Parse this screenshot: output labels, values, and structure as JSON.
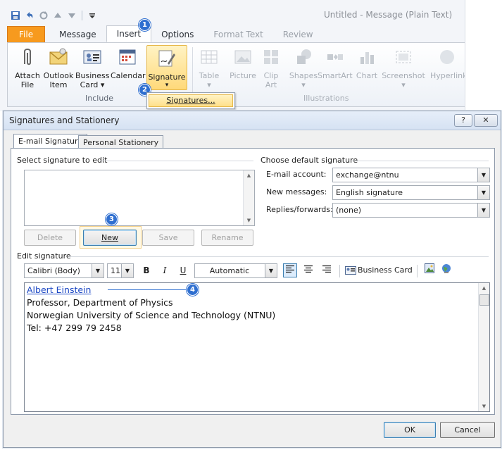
{
  "window": {
    "title": "Untitled - Message (Plain Text)",
    "qat": [
      "save-icon",
      "undo-icon",
      "redo-icon",
      "up-arrow-icon",
      "down-arrow-icon",
      "customize-icon"
    ]
  },
  "ribbon": {
    "tabs": [
      {
        "label": "File"
      },
      {
        "label": "Message"
      },
      {
        "label": "Insert"
      },
      {
        "label": "Options"
      },
      {
        "label": "Format Text"
      },
      {
        "label": "Review"
      }
    ],
    "include_buttons": [
      {
        "label1": "Attach",
        "label2": "File"
      },
      {
        "label1": "Outlook",
        "label2": "Item"
      },
      {
        "label1": "Business",
        "label2": "Card ▾"
      },
      {
        "label1": "Calendar",
        "label2": ""
      }
    ],
    "signature": {
      "label": "Signature",
      "arrow": "▾"
    },
    "include_label": "Include",
    "disabled_buttons": [
      {
        "label1": "Table",
        "label2": "▾"
      },
      {
        "label1": "Picture",
        "label2": ""
      },
      {
        "label1": "Clip",
        "label2": "Art"
      },
      {
        "label1": "Shapes",
        "label2": "▾"
      },
      {
        "label1": "SmartArt",
        "label2": ""
      },
      {
        "label1": "Chart",
        "label2": ""
      },
      {
        "label1": "Screenshot",
        "label2": "▾"
      },
      {
        "label1": "Hyperlink",
        "label2": ""
      }
    ],
    "illustrations_label": "Illustrations",
    "menu_item": "Signatures...",
    "callouts": [
      "1",
      "2"
    ]
  },
  "dialog": {
    "title": "Signatures and Stationery",
    "help": "?",
    "close": "✕",
    "tabs": [
      {
        "label": "E-mail Signature"
      },
      {
        "label": "Personal Stationery"
      }
    ],
    "select_label": "Select signature to edit",
    "default_label": "Choose default signature",
    "email_account_label": "E-mail account:",
    "email_account_value": "exchange@ntnu",
    "new_messages_label": "New messages:",
    "new_messages_value": "English signature",
    "replies_label": "Replies/forwards:",
    "replies_value": "(none)",
    "buttons": {
      "delete": "Delete",
      "new": "New",
      "save": "Save",
      "rename": "Rename"
    },
    "callout_new": "3",
    "edit_label": "Edit signature",
    "font_name": "Calibri (Body)",
    "font_size": "11",
    "bold": "B",
    "italic": "I",
    "underline": "U",
    "color_value": "Automatic",
    "business_card": "Business Card",
    "signature_lines": [
      "Albert Einstein",
      "Professor, Department of Physics",
      "Norwegian University of Science and Technology (NTNU)",
      "Tel: +47 299 79 2458"
    ],
    "callout_sig": "4",
    "ok": "OK",
    "cancel": "Cancel"
  }
}
